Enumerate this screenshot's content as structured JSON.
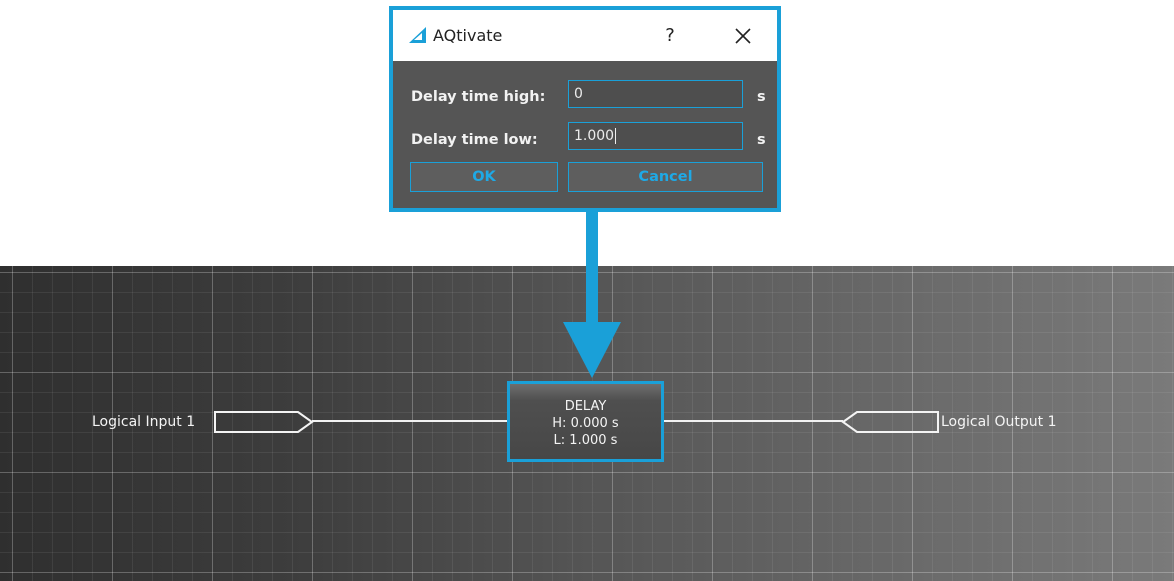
{
  "dialog": {
    "title": "AQtivate",
    "help_label": "?",
    "close_icon": "close-icon",
    "logo_icon": "aqtivate-logo-icon",
    "fields": [
      {
        "label": "Delay time high:",
        "value": "0",
        "unit": "s"
      },
      {
        "label": "Delay time low:",
        "value": "1.000",
        "unit": "s"
      }
    ],
    "ok_label": "OK",
    "cancel_label": "Cancel"
  },
  "canvas": {
    "input_label": "Logical Input 1",
    "output_label": "Logical Output 1",
    "delay_block": {
      "title": "DELAY",
      "high": "H: 0.000 s",
      "low": "L: 1.000 s"
    }
  },
  "colors": {
    "accent": "#1aa0d8",
    "dialog_bg": "#555555",
    "button_text": "#1ea9e6",
    "canvas_dark": "#2f2f2f",
    "canvas_light": "#7a7a7a"
  }
}
